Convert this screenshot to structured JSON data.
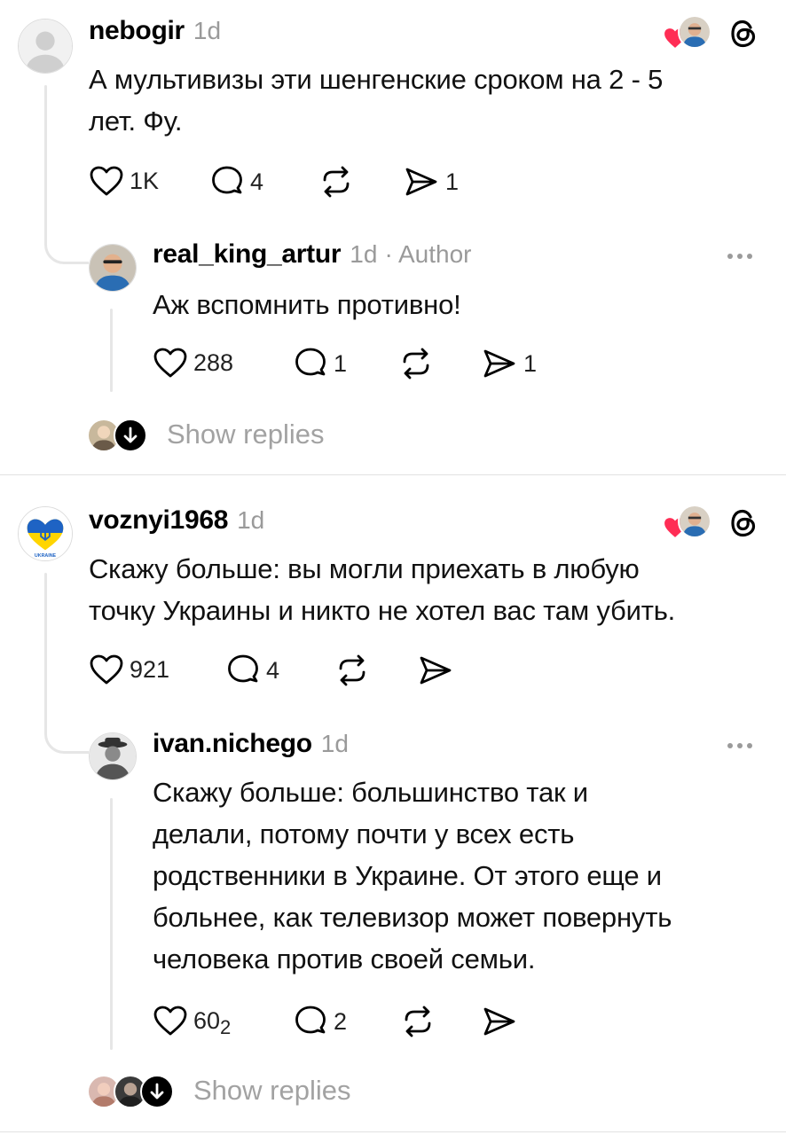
{
  "posts": [
    {
      "username": "nebogir",
      "time": "1d",
      "text_lines": [
        "А мультивизы эти шенгенские сроком на 2 - 5",
        "лет. Фу."
      ],
      "likes": "1K",
      "replies": "4",
      "shares": "1",
      "reply": {
        "username": "real_king_artur",
        "time": "1d",
        "author_tag": "· Author",
        "text_lines": [
          "Аж вспомнить противно!"
        ],
        "likes": "288",
        "replies": "1",
        "shares": "1"
      },
      "show_replies": "Show replies"
    },
    {
      "username": "voznyi1968",
      "time": "1d",
      "avatar_text": "UKRAINE",
      "text_lines": [
        "Скажу больше: вы могли приехать в любую",
        "точку Украины и никто не хотел вас там убить."
      ],
      "likes": "921",
      "replies": "4",
      "reply": {
        "username": "ivan.nichego",
        "time": "1d",
        "text_lines": [
          "Скажу больше: большинство так и",
          "делали, потому почти у всех есть",
          "родственники в Украине. От этого еще и",
          "больнее, как телевизор может повернуть",
          "человека против своей семьи."
        ],
        "likes": "60",
        "likes_sub": "2",
        "replies": "2"
      },
      "show_replies": "Show replies"
    }
  ],
  "colors": {
    "heart": "#ff2d55",
    "meta": "#9a9a9a",
    "thread_line": "#e6e6e6"
  },
  "icons": [
    "heart-icon",
    "comment-icon",
    "repost-icon",
    "share-icon",
    "threads-logo-icon",
    "more-icon",
    "chevron-down-icon"
  ]
}
